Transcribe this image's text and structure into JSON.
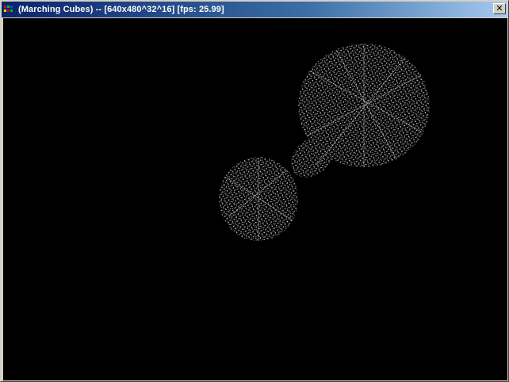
{
  "window": {
    "title": "(Marching Cubes) -- [640x480^32^16] [fps: 25.99]",
    "close_glyph": "✕"
  },
  "scene": {
    "background": "#000000",
    "mesh_color": "#ffffff",
    "shape": "wireframe-metaballs"
  },
  "colors": {
    "title_start": "#0a246a",
    "title_end": "#a6caf0",
    "chrome": "#d4d0c8"
  }
}
